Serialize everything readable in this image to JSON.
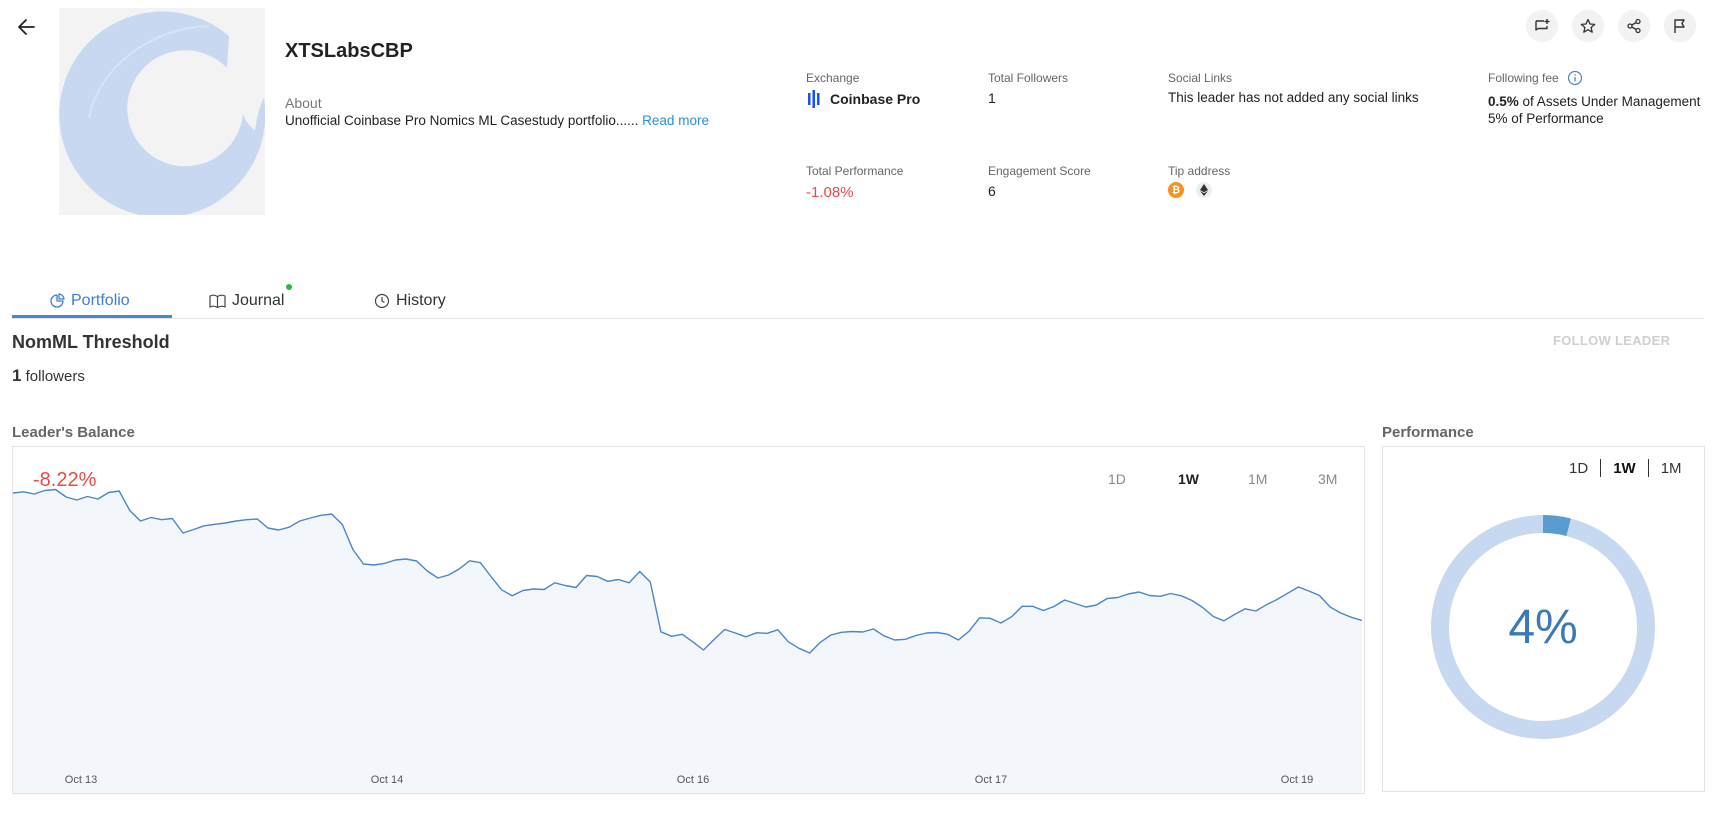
{
  "leader": {
    "name": "XTSLabsCBP",
    "about_label": "About",
    "about_text": "Unofficial Coinbase Pro Nomics ML Casestudy portfolio......",
    "read_more": "Read more"
  },
  "stats": {
    "exchange_label": "Exchange",
    "exchange_value": "Coinbase Pro",
    "followers_label": "Total Followers",
    "followers_value": "1",
    "social_label": "Social Links",
    "social_value": "This leader has not added any social links",
    "fee_label": "Following fee",
    "fee_line1_value": "0.5%",
    "fee_line1_text": "of Assets Under Management",
    "fee_line2_value": "5%",
    "fee_line2_text": "of Performance",
    "performance_label": "Total Performance",
    "performance_value": "-1.08%",
    "engagement_label": "Engagement Score",
    "engagement_value": "6",
    "tip_label": "Tip address"
  },
  "tabs": [
    {
      "label": "Portfolio",
      "active": true
    },
    {
      "label": "Journal",
      "active": false
    },
    {
      "label": "History",
      "active": false
    }
  ],
  "portfolio": {
    "title": "NomML Threshold",
    "followers_count": "1",
    "followers_text": "followers",
    "follow_button": "FOLLOW LEADER"
  },
  "balance": {
    "title": "Leader's Balance",
    "change": "-8.22%",
    "ranges": [
      "1D",
      "1W",
      "1M",
      "3M"
    ],
    "selected_range": "1W"
  },
  "performance": {
    "title": "Performance",
    "ranges": [
      "1D",
      "1W",
      "1M"
    ],
    "selected_range": "1W",
    "value_label": "4%",
    "value": 4
  },
  "colors": {
    "accent": "#3f7fc9",
    "negative": "#e84b4b",
    "line": "#4a86c8",
    "area": "#f3f7fc",
    "donut_track": "#c6d9f0",
    "donut_fill": "#5a9bd0"
  },
  "chart_data": {
    "type": "area",
    "x_ticks": [
      "Oct 13",
      "Oct 14",
      "Oct 16",
      "Oct 17",
      "Oct 19"
    ],
    "values": [
      97.6,
      98.1,
      97.2,
      98.6,
      99.0,
      96.0,
      94.8,
      96.2,
      95.2,
      97.8,
      98.4,
      90.6,
      86.4,
      87.8,
      86.9,
      87.4,
      81.6,
      83.0,
      84.5,
      85.1,
      85.6,
      86.4,
      86.9,
      87.2,
      83.6,
      82.8,
      83.9,
      86.4,
      87.6,
      88.7,
      89.2,
      85.0,
      75.0,
      69.2,
      68.8,
      69.5,
      70.8,
      71.2,
      70.4,
      66.4,
      63.6,
      64.8,
      67.2,
      70.5,
      69.7,
      64.2,
      58.9,
      56.5,
      58.6,
      59.2,
      59.0,
      61.7,
      60.6,
      59.8,
      64.6,
      64.2,
      62.3,
      63.0,
      61.7,
      66.2,
      62.0,
      42.1,
      40.3,
      41.1,
      38.1,
      34.8,
      39.0,
      43.0,
      41.6,
      40.1,
      41.7,
      41.5,
      42.9,
      38.1,
      35.5,
      33.6,
      37.9,
      40.8,
      41.9,
      42.2,
      42.0,
      43.2,
      40.5,
      38.8,
      39.1,
      40.6,
      41.6,
      41.8,
      41.1,
      38.8,
      42.3,
      47.7,
      47.5,
      45.6,
      48.1,
      52.3,
      52.3,
      50.6,
      52.2,
      54.8,
      53.4,
      52.0,
      52.8,
      55.4,
      55.8,
      57.2,
      58.0,
      56.6,
      56.3,
      57.4,
      56.5,
      54.6,
      51.8,
      48.2,
      46.5,
      49.0,
      51.3,
      50.4,
      52.9,
      55.0,
      57.5,
      60.0,
      58.4,
      56.6,
      52.0,
      49.6,
      47.9,
      46.6
    ]
  }
}
